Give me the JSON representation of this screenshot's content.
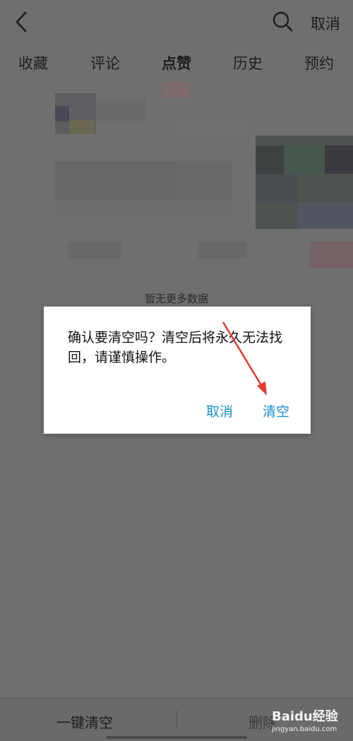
{
  "header": {
    "cancel_label": "取消"
  },
  "tabs": [
    {
      "label": "收藏"
    },
    {
      "label": "评论"
    },
    {
      "label": "点赞",
      "active": true
    },
    {
      "label": "历史"
    },
    {
      "label": "预约"
    }
  ],
  "list": {
    "end_text": "暂无更多数据"
  },
  "dialog": {
    "message": "确认要清空吗？清空后将永久无法找回，请谨慎操作。",
    "cancel_label": "取消",
    "confirm_label": "清空",
    "accent_color": "#1a8fd6"
  },
  "bottom_bar": {
    "clear_all_label": "一键清空",
    "delete_label": "删除"
  },
  "watermark": {
    "brand": "Baidu经验",
    "url": "jingyan.baidu.com"
  },
  "icons": [
    "back-arrow-icon",
    "search-icon",
    "paw-icon",
    "red-arrow-annotation"
  ]
}
